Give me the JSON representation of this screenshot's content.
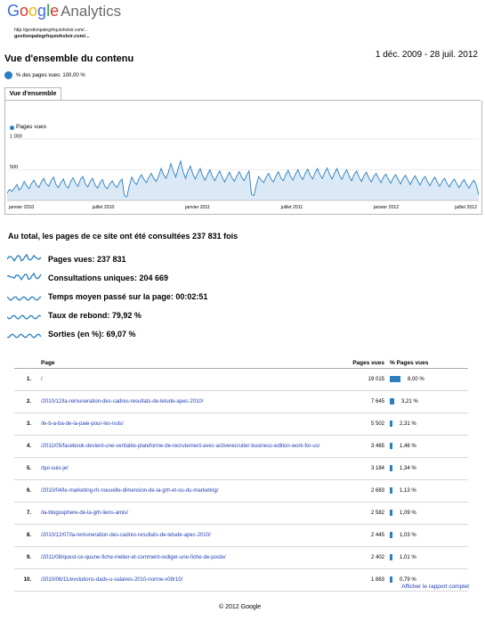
{
  "brand": {
    "letters": [
      "G",
      "o",
      "o",
      "g",
      "l",
      "e"
    ],
    "product": "Analytics"
  },
  "site": {
    "url1": "http://gestionpalegrhquioholsir.com/...",
    "url2": "gestionpalegrhquioholsir.com/..."
  },
  "header": {
    "title": "Vue d'ensemble du contenu",
    "date_range": "1 déc. 2009 - 28 juil. 2012"
  },
  "segment": {
    "label": "% des pages vues: 100,00 %"
  },
  "tab": {
    "label": "Vue d'ensemble"
  },
  "chart_data": {
    "type": "area",
    "legend": "Pages vues",
    "y_ticks": [
      "1 000",
      "500"
    ],
    "ylim": [
      0,
      1000
    ],
    "x_labels": [
      "janvier 2010",
      "juillet 2010",
      "janvier 2011",
      "juillet 2011",
      "janvier 2012",
      "juillet 2012"
    ],
    "values": [
      120,
      180,
      150,
      200,
      260,
      170,
      220,
      310,
      240,
      190,
      280,
      330,
      250,
      210,
      300,
      360,
      270,
      230,
      320,
      380,
      260,
      210,
      290,
      350,
      240,
      200,
      310,
      370,
      280,
      230,
      340,
      390,
      270,
      220,
      310,
      360,
      250,
      200,
      290,
      340,
      230,
      190,
      270,
      320,
      250,
      210,
      300,
      350,
      80,
      60,
      240,
      380,
      300,
      260,
      360,
      420,
      340,
      290,
      380,
      440,
      360,
      310,
      400,
      520,
      420,
      360,
      460,
      600,
      480,
      380,
      520,
      640,
      470,
      360,
      480,
      560,
      430,
      350,
      440,
      520,
      400,
      330,
      420,
      500,
      390,
      320,
      410,
      480,
      380,
      300,
      390,
      460,
      370,
      310,
      400,
      470,
      380,
      320,
      410,
      480,
      100,
      80,
      260,
      390,
      330,
      290,
      380,
      440,
      350,
      300,
      400,
      470,
      370,
      320,
      420,
      490,
      390,
      330,
      430,
      500,
      400,
      340,
      440,
      510,
      410,
      350,
      450,
      520,
      420,
      360,
      460,
      530,
      420,
      350,
      450,
      520,
      410,
      340,
      440,
      500,
      390,
      320,
      420,
      480,
      380,
      310,
      400,
      460,
      370,
      300,
      390,
      440,
      360,
      290,
      380,
      430,
      350,
      280,
      370,
      420,
      340,
      270,
      360,
      410,
      330,
      260,
      350,
      400,
      320,
      250,
      340,
      390,
      310,
      240,
      320,
      380,
      300,
      230,
      310,
      360,
      280,
      220,
      300,
      350,
      270,
      210,
      290,
      340,
      260,
      200,
      280,
      330,
      250,
      90
    ]
  },
  "summary": {
    "total_text": "Au total, les pages de ce site ont été consultées 237 831 fois"
  },
  "metrics": [
    {
      "label": "Pages vues: 237 831"
    },
    {
      "label": "Consultations uniques: 204 669"
    },
    {
      "label": "Temps moyen passé sur la page: 00:02:51"
    },
    {
      "label": "Taux de rebond: 79,92 %"
    },
    {
      "label": "Sorties (en %): 69,07 %"
    }
  ],
  "table": {
    "headers": {
      "page": "Page",
      "views": "Pages vues",
      "pct": "% Pages vues"
    },
    "rows": [
      {
        "n": "1.",
        "page": "/",
        "views": "19 015",
        "pct": "8,00 %",
        "frac": 0.08
      },
      {
        "n": "2.",
        "page": "/2010/12/la-remuneration-des-cadres-resultats-de-letude-apec-2010/",
        "views": "7 645",
        "pct": "3,21 %",
        "frac": 0.0321
      },
      {
        "n": "3.",
        "page": "/le-b-a-ba-de-la-paie-pour-les-nuls/",
        "views": "5 502",
        "pct": "2,31 %",
        "frac": 0.0231
      },
      {
        "n": "4.",
        "page": "/2011/05/facebook-devient-une-veritable-plateforme-de-recrutement-avec-activerecruiter-business-edition-work-for-us/",
        "views": "3 465",
        "pct": "1,46 %",
        "frac": 0.0146
      },
      {
        "n": "5.",
        "page": "/qui-suis-je/",
        "views": "3 184",
        "pct": "1,34 %",
        "frac": 0.0134
      },
      {
        "n": "6.",
        "page": "/2010/04/le-marketing-rh-nouvelle-dimension-de-la-grh-et-ou-du-marketing/",
        "views": "2 683",
        "pct": "1,13 %",
        "frac": 0.0113
      },
      {
        "n": "7.",
        "page": "/la-blogosphere-de-la-grh-liens-amis/",
        "views": "2 582",
        "pct": "1,09 %",
        "frac": 0.0109
      },
      {
        "n": "8.",
        "page": "/2010/12/07/la-remuneration-des-cadres-resultats-de-letude-apec-2010/",
        "views": "2 445",
        "pct": "1,03 %",
        "frac": 0.0103
      },
      {
        "n": "9.",
        "page": "/2011/08/quest-ce-quune-fiche-metier-et-comment-rediger-une-fiche-de-poste/",
        "views": "2 402",
        "pct": "1,01 %",
        "frac": 0.0101
      },
      {
        "n": "10.",
        "page": "/2010/06/11/evolutions-dads-u-salaires-2010-norme-v08r10/",
        "views": "1 883",
        "pct": "0,79 %",
        "frac": 0.0079
      }
    ]
  },
  "links": {
    "full_report": "Afficher le rapport complet"
  },
  "footer": {
    "copyright": "© 2012 Google"
  }
}
